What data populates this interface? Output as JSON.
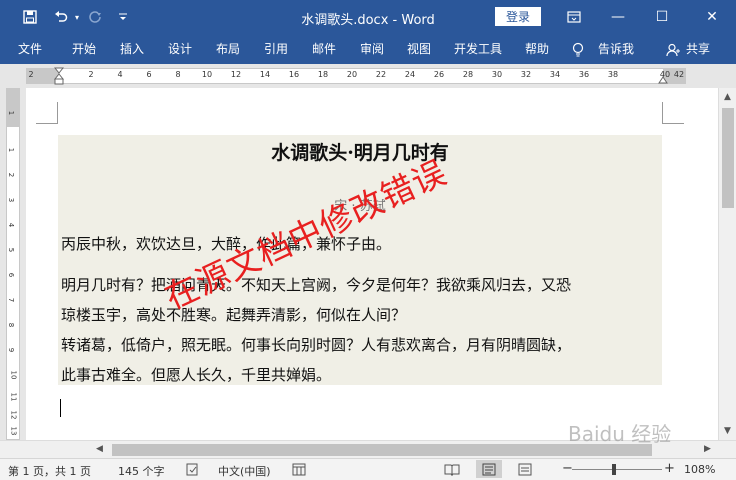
{
  "titlebar": {
    "title": "水调歌头.docx  -  Word",
    "login": "登录",
    "qa": {
      "save_icon": "floppy-icon",
      "undo_icon": "undo-icon",
      "redo_icon": "redo-icon",
      "customize_icon": "chevron-down-icon"
    },
    "window": {
      "ribbon_display": "ribbon-display-icon",
      "minimize": "—",
      "maximize": "☐",
      "close": "✕"
    }
  },
  "ribbon": {
    "tabs": [
      "文件",
      "开始",
      "插入",
      "设计",
      "布局",
      "引用",
      "邮件",
      "审阅",
      "视图",
      "开发工具",
      "帮助"
    ],
    "tell_me": "告诉我",
    "share": "共享"
  },
  "ruler": {
    "h_numbers": [
      "2",
      "2",
      "4",
      "6",
      "8",
      "10",
      "12",
      "14",
      "16",
      "18",
      "20",
      "22",
      "24",
      "26",
      "28",
      "30",
      "32",
      "34",
      "36",
      "38",
      "40",
      "42"
    ],
    "v_numbers": [
      "1",
      "1",
      "2",
      "3",
      "4",
      "5",
      "6",
      "7",
      "8",
      "9",
      "10",
      "11",
      "12",
      "13"
    ]
  },
  "document": {
    "title": "水调歌头·明月几时有",
    "author": "宋 · 苏轼",
    "lines": [
      "丙辰中秋，欢饮达旦，大醉，作此篇，兼怀子由。",
      "明月几时有？把酒问青天。不知天上宫阙，今夕是何年？我欲乘风归去，又恐",
      "琼楼玉宇，高处不胜寒。起舞弄清影，何似在人间？",
      "转诸葛，低倚户，照无眠。何事长向别时圆？人有悲欢离合，月有阴晴圆缺，",
      "此事古难全。但愿人长久，千里共婵娟。"
    ],
    "watermark": "在源文档中修改错误"
  },
  "status": {
    "page": "第 1 页，共 1 页",
    "words": "145 个字",
    "language": "中文(中国)",
    "zoom": "108%",
    "zoom_minus": "−",
    "zoom_plus": "+"
  },
  "site_watermark": "Baidu 经验",
  "colors": {
    "accent": "#2b579a",
    "watermark": "#e82020",
    "shade": "#f0efe6"
  }
}
